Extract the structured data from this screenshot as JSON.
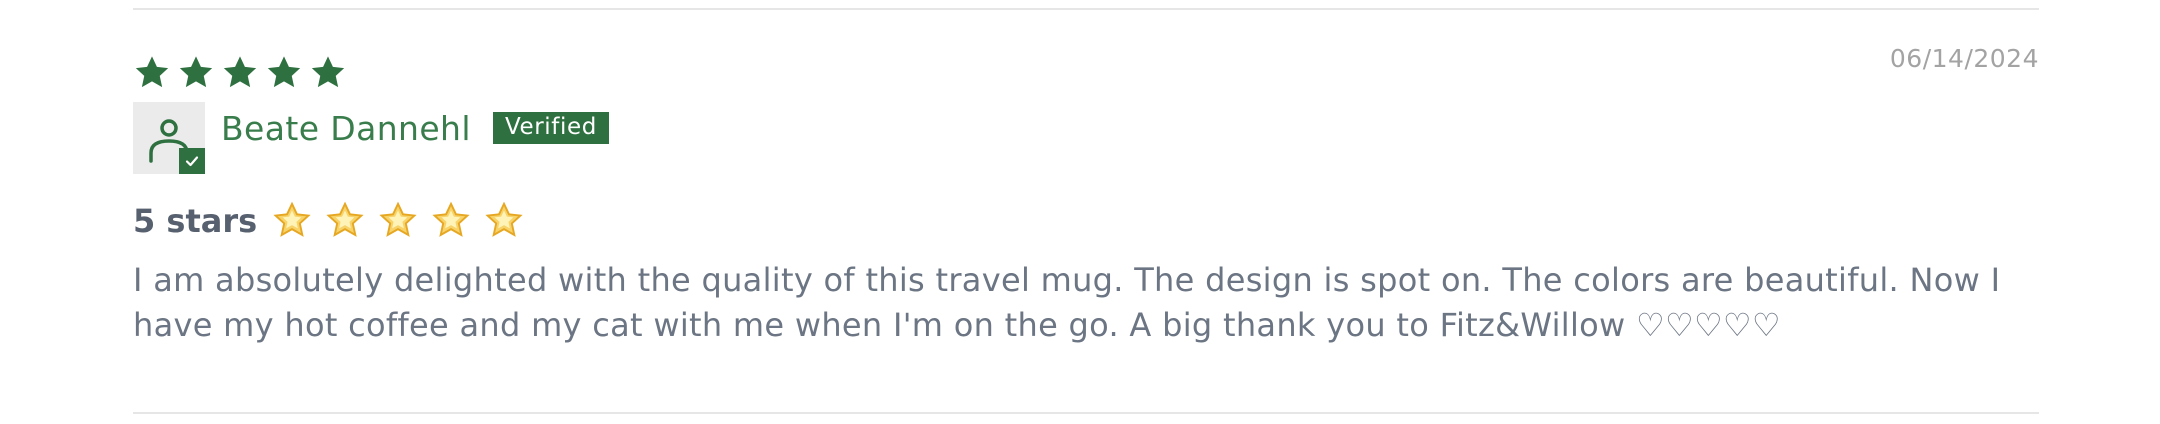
{
  "review": {
    "rating": 5,
    "rating_max": 5,
    "date": "06/14/2024",
    "author": "Beate Dannehl",
    "badge": "Verified",
    "title": "5 stars",
    "title_emoji_count": 5,
    "body": "I am absolutely delighted with the quality of this travel mug. The design is spot on. The colors are beautiful. Now I have my hot coffee and my cat with me when I'm on the go. A big thank you to Fitz&Willow ♡♡♡♡♡"
  },
  "colors": {
    "accent_green": "#2e7040",
    "name_green": "#3a7d4c",
    "date_gray": "#a3a3a3",
    "text_gray": "#6b7583",
    "title_gray": "#56606e"
  },
  "icons": {
    "rating_star": "star-icon",
    "avatar": "user-icon",
    "verified_check": "check-icon",
    "title_emoji": "glowing-star-icon"
  }
}
